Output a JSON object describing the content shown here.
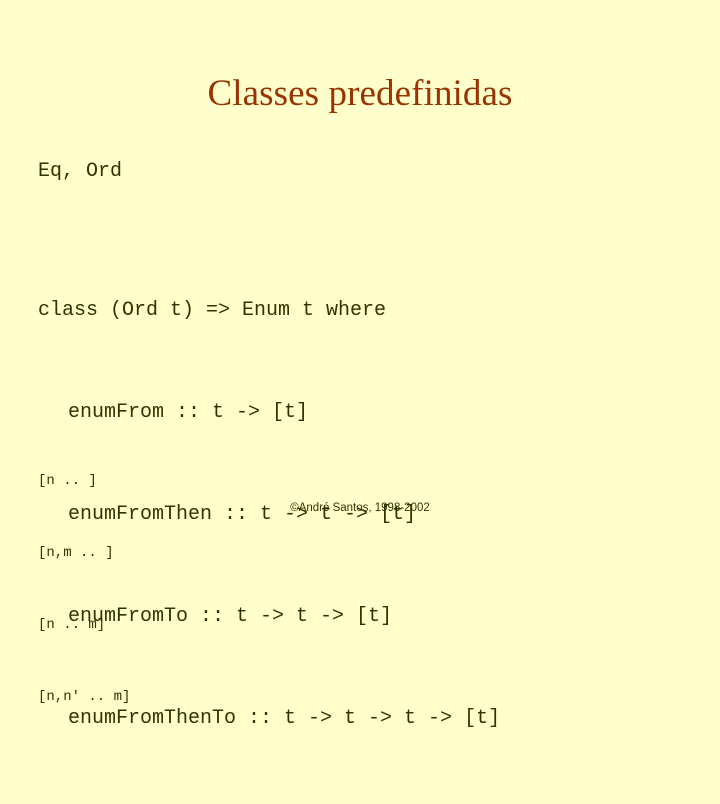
{
  "slide": {
    "background_color": "#ffffcc",
    "title": "Classes predefinidas",
    "title_color": "#993300",
    "code_color": "#333300",
    "classes_line": "Eq, Ord",
    "declaration": {
      "header": "class (Ord t) => Enum t where",
      "members": [
        "enumFrom :: t -> [t]",
        "enumFromThen :: t -> t -> [t]",
        "enumFromTo :: t -> t -> [t]",
        "enumFromThenTo :: t -> t -> t -> [t]"
      ]
    },
    "ranges": [
      "[n .. ]",
      "[n,m .. ]",
      "[n .. m]",
      "[n,n' .. m]"
    ],
    "footer": "©André Santos, 1998-2002"
  }
}
